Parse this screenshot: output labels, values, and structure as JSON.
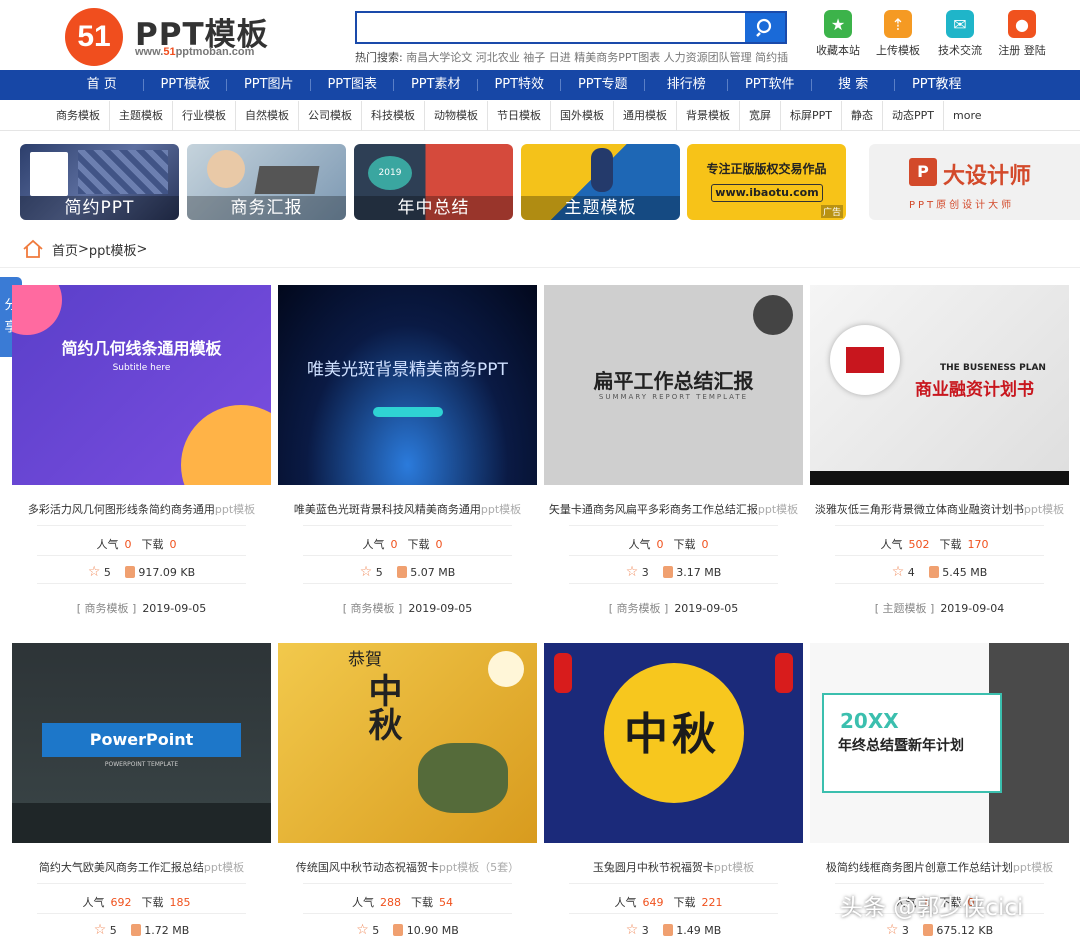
{
  "header": {
    "logo_mark": "51",
    "logo_title": "PPT模板",
    "logo_url_pre": "www.",
    "logo_url_mid": "51",
    "logo_url_post": "pptmoban.com",
    "search_placeholder": "",
    "hot_label": "热门搜索:",
    "hot_terms": "南昌大学论文 河北农业 袖子 日进 精美商务PPT图表 人力资源团队管理 简约插",
    "tools": [
      {
        "label": "收藏本站",
        "icon": "star-icon",
        "color": "#3cb34a"
      },
      {
        "label": "上传模板",
        "icon": "cloud-upload-icon",
        "color": "#f59a23"
      },
      {
        "label": "技术交流",
        "icon": "chat-icon",
        "color": "#1fb5c9"
      },
      {
        "label": "注册 登陆",
        "icon": "user-icon",
        "color": "#f0521e"
      }
    ]
  },
  "nav": [
    "首 页",
    "PPT模板",
    "PPT图片",
    "PPT图表",
    "PPT素材",
    "PPT特效",
    "PPT专题",
    "排行榜",
    "PPT软件",
    "搜 索",
    "PPT教程"
  ],
  "subnav": [
    "商务模板",
    "主题模板",
    "行业模板",
    "自然模板",
    "公司模板",
    "科技模板",
    "动物模板",
    "节日模板",
    "国外模板",
    "通用模板",
    "背景模板",
    "宽屏",
    "标屏PPT",
    "静态",
    "动态PPT",
    "more"
  ],
  "banners": [
    {
      "caption": "简约PPT",
      "bg": "#3a4a78"
    },
    {
      "caption": "商务汇报",
      "bg": "#8fa9bf"
    },
    {
      "caption": "年中总结",
      "bg": "#c8443a"
    },
    {
      "caption": "主题模板",
      "bg": "#2b6cb0"
    },
    {
      "caption": "专注正版版权交易作品",
      "sub": "www.ibaotu.com",
      "ad": "广告",
      "bg": "#f7c318"
    },
    {
      "caption": "大设计师",
      "sub": "PPT原创设计大师",
      "bg": "#f1f1f1"
    }
  ],
  "breadcrumb": {
    "home": "首页",
    "sep1": " > ",
    "current": "ppt模板",
    "sep2": " >"
  },
  "share_label": "分享",
  "cards": [
    {
      "title": "多彩活力风几何图形线条简约商务通用",
      "suffix": "ppt模板",
      "pop_label": "人气",
      "pop": "0",
      "dl_label": "下载",
      "dl": "0",
      "stars": "5",
      "size": "917.09 KB",
      "category": "[ 商务模板 ]",
      "date": "2019-09-05",
      "thumb_title": "简约几何线条通用模板",
      "thumb_sub": "Subtitle here"
    },
    {
      "title": "唯美蓝色光斑背景科技风精美商务通用",
      "suffix": "ppt模板",
      "pop_label": "人气",
      "pop": "0",
      "dl_label": "下载",
      "dl": "0",
      "stars": "5",
      "size": "5.07 MB",
      "category": "[ 商务模板 ]",
      "date": "2019-09-05",
      "thumb_title": "唯美光斑背景精美商务PPT",
      "thumb_sub": ""
    },
    {
      "title": "矢量卡通商务风扁平多彩商务工作总结汇报",
      "suffix": "ppt模板",
      "pop_label": "人气",
      "pop": "0",
      "dl_label": "下载",
      "dl": "0",
      "stars": "3",
      "size": "3.17 MB",
      "category": "[ 商务模板 ]",
      "date": "2019-09-05",
      "thumb_title": "扁平工作总结汇报",
      "thumb_sub": "SUMMARY REPORT TEMPLATE"
    },
    {
      "title": "淡雅灰低三角形背景微立体商业融资计划书",
      "suffix": "ppt模板",
      "pop_label": "人气",
      "pop": "502",
      "dl_label": "下载",
      "dl": "170",
      "stars": "4",
      "size": "5.45 MB",
      "category": "[ 主题模板 ]",
      "date": "2019-09-04",
      "thumb_title": "商业融资计划书",
      "thumb_sub": "THE BUSENESS PLAN"
    },
    {
      "title": "简约大气欧美风商务工作汇报总结",
      "suffix": "ppt模板",
      "pop_label": "人气",
      "pop": "692",
      "dl_label": "下载",
      "dl": "185",
      "stars": "5",
      "size": "1.72 MB",
      "thumb_title": "PowerPoint",
      "thumb_sub": "POWERPOINT TEMPLATE"
    },
    {
      "title": "传统国风中秋节动态祝福贺卡",
      "suffix": "ppt模板（5套）",
      "pop_label": "人气",
      "pop": "288",
      "dl_label": "下载",
      "dl": "54",
      "stars": "5",
      "size": "10.90 MB",
      "thumb_title": "中秋",
      "thumb_sub": "恭賀"
    },
    {
      "title": "玉兔圆月中秋节祝福贺卡",
      "suffix": "ppt模板",
      "pop_label": "人气",
      "pop": "649",
      "dl_label": "下载",
      "dl": "221",
      "stars": "3",
      "size": "1.49 MB",
      "thumb_title": "中秋",
      "thumb_sub": ""
    },
    {
      "title": "极简约线框商务图片创意工作总结计划",
      "suffix": "ppt模板",
      "pop_label": "人气",
      "pop": "1",
      "dl_label": "下载",
      "dl": "0",
      "stars": "3",
      "size": "675.12 KB",
      "thumb_title": "年终总结暨新年计划",
      "thumb_sub": "20XX"
    }
  ],
  "watermark": "头条 @郭少侠cici"
}
